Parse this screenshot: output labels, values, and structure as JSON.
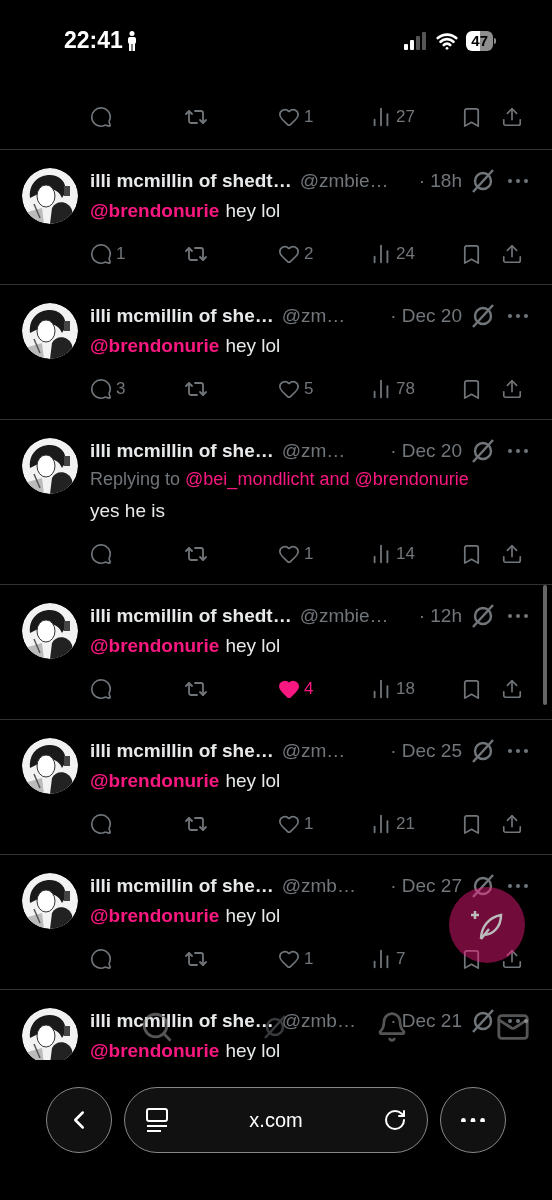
{
  "status_bar": {
    "time": "22:41",
    "battery": "47"
  },
  "partial_tweet": {
    "likes": "1",
    "liked": false,
    "views": "27"
  },
  "tweets": [
    {
      "name": "illi mcmillin of shedt…",
      "handle": "@zmbie…",
      "time": "· 18h",
      "mention": "@brendonurie",
      "text": "hey lol",
      "replies": "1",
      "likes": "2",
      "liked": false,
      "views": "24"
    },
    {
      "name": "illi mcmillin of she…",
      "handle": "@zm…",
      "time": "· Dec 20",
      "mention": "@brendonurie",
      "text": "hey lol",
      "replies": "3",
      "likes": "5",
      "liked": false,
      "views": "78"
    },
    {
      "name": "illi mcmillin of she…",
      "handle": "@zm…",
      "time": "· Dec 20",
      "replying_prefix": "Replying to",
      "replying_to": "@bei_mondlicht and @brendonurie",
      "text": "yes he is",
      "likes": "1",
      "liked": false,
      "views": "14"
    },
    {
      "name": "illi mcmillin of shedt…",
      "handle": "@zmbie…",
      "time": "· 12h",
      "mention": "@brendonurie",
      "text": "hey lol",
      "likes": "4",
      "liked": true,
      "views": "18"
    },
    {
      "name": "illi mcmillin of she…",
      "handle": "@zm…",
      "time": "· Dec 25",
      "mention": "@brendonurie",
      "text": "hey lol",
      "likes": "1",
      "liked": false,
      "views": "21"
    },
    {
      "name": "illi mcmillin of she…",
      "handle": "@zmb…",
      "time": "· Dec 27",
      "mention": "@brendonurie",
      "text": "hey lol",
      "likes": "1",
      "liked": false,
      "views": "7"
    },
    {
      "name": "illi mcmillin of she…",
      "handle": "@zmb…",
      "time": "· Dec 21",
      "mention": "@brendonurie",
      "text": "hey lol",
      "cut": true
    }
  ],
  "browser_bar": {
    "url": "x.com"
  }
}
